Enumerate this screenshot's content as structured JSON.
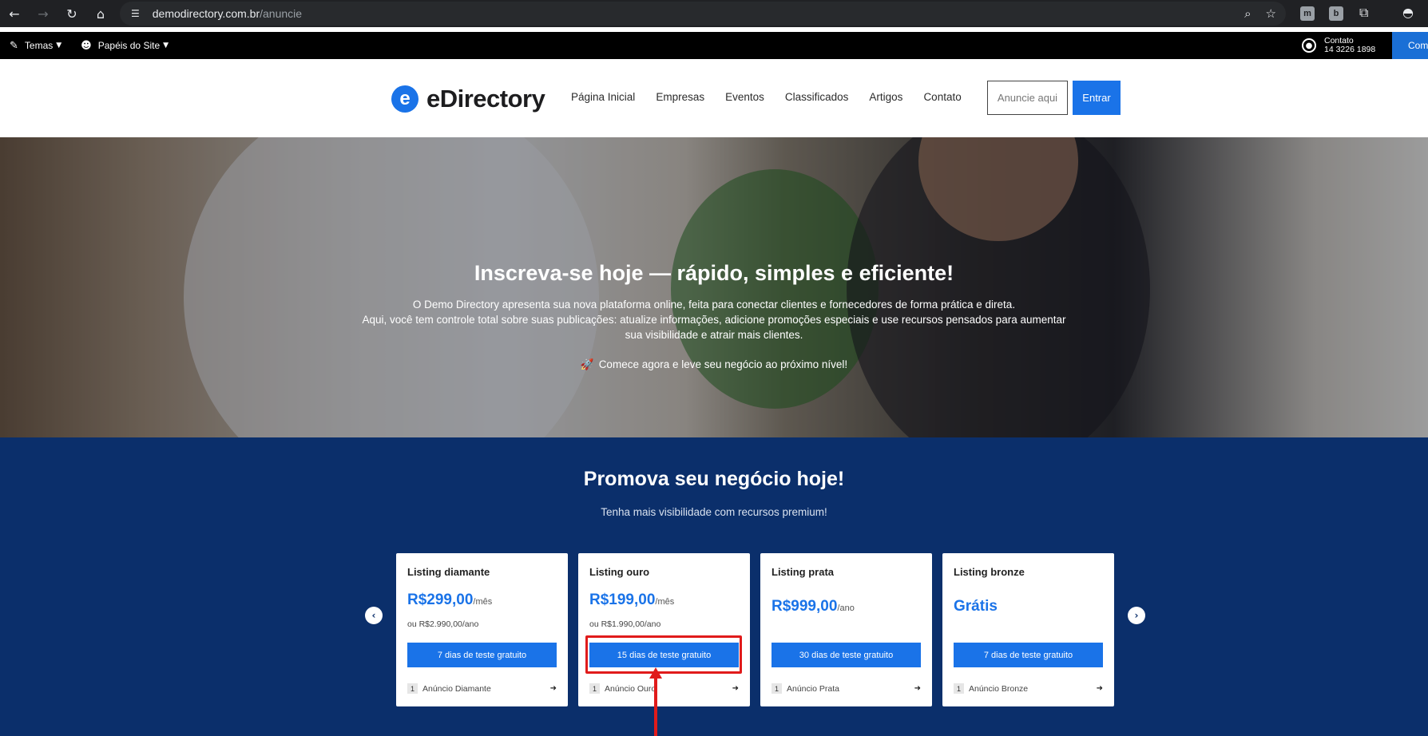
{
  "browser": {
    "url_host": "demodirectory.com.br",
    "url_path": "/anuncie",
    "ext_m": "m",
    "ext_b": "b"
  },
  "admin_bar": {
    "themes": "Temas",
    "site_roles": "Papéis do Site",
    "contact_label": "Contato",
    "contact_phone": "14 3226 1898",
    "comp_label": "Comp"
  },
  "header": {
    "logo_mark": "e",
    "logo_text": "eDirectory",
    "nav": [
      "Página Inicial",
      "Empresas",
      "Eventos",
      "Classificados",
      "Artigos",
      "Contato"
    ],
    "advertise_button": "Anuncie aqui",
    "login_button": "Entrar"
  },
  "hero": {
    "title": "Inscreva-se hoje — rápido, simples e eficiente!",
    "line1": "O Demo Directory apresenta sua nova plataforma online, feita para conectar clientes e fornecedores de forma prática e direta.",
    "line2": "Aqui, você tem controle total sobre suas publicações: atualize informações, adicione promoções especiais e use recursos pensados para aumentar",
    "line3": "sua visibilidade e atrair mais clientes.",
    "cta": "Comece agora e leve seu negócio ao próximo nível!",
    "cta_icon": "🚀"
  },
  "pricing": {
    "title": "Promova seu negócio hoje!",
    "subtitle": "Tenha mais visibilidade com recursos premium!",
    "plans": [
      {
        "name": "Listing diamante",
        "price": "R$299,00",
        "period": "/mês",
        "alt": "ou R$2.990,00/ano",
        "button": "7 dias de teste gratuito",
        "count": "1",
        "label": "Anúncio Diamante"
      },
      {
        "name": "Listing ouro",
        "price": "R$199,00",
        "period": "/mês",
        "alt": "ou R$1.990,00/ano",
        "button": "15 dias de teste gratuito",
        "count": "1",
        "label": "Anúncio Ouro"
      },
      {
        "name": "Listing prata",
        "price": "R$999,00",
        "period": "/ano",
        "alt": "",
        "button": "30 dias de teste gratuito",
        "count": "1",
        "label": "Anúncio Prata"
      },
      {
        "name": "Listing bronze",
        "price": "Grátis",
        "period": "",
        "alt": "",
        "button": "7 dias de teste gratuito",
        "count": "1",
        "label": "Anúncio Bronze"
      }
    ]
  },
  "colors": {
    "brand_blue": "#1a73e8",
    "section_navy": "#0b2f6b",
    "annotation_red": "#e01b1b"
  }
}
